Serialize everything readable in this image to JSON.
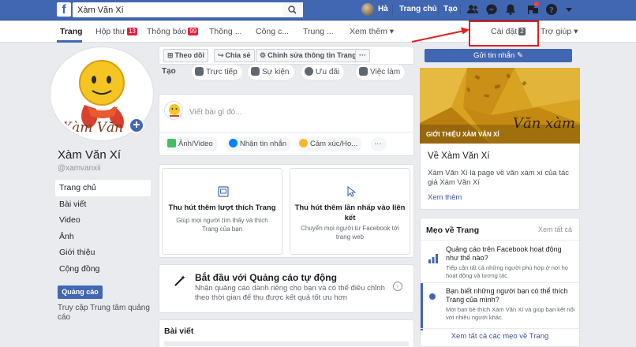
{
  "topbar": {
    "search_value": "Xàm Văn Xí",
    "user_name": "Hà",
    "home": "Trang chủ",
    "create": "Tạo",
    "icons": [
      "friends-icon",
      "messenger-icon",
      "bell-icon",
      "pages-icon",
      "help-icon",
      "caret-icon"
    ]
  },
  "pagenav": {
    "items": [
      {
        "label": "Trang"
      },
      {
        "label": "Hộp thư",
        "badge": "13"
      },
      {
        "label": "Thông báo",
        "badge": "99"
      },
      {
        "label": "Thông ..."
      },
      {
        "label": "Công c..."
      },
      {
        "label": "Trung ..."
      },
      {
        "label": "Xem thêm ▾"
      },
      {
        "label": "Cài đặt",
        "badge": "2"
      },
      {
        "label": "Trợ giúp ▾"
      }
    ]
  },
  "profile": {
    "name": "Xàm Văn Xí",
    "handle": "@xamvanxii",
    "logo_text": "Xàm Văn",
    "menu": [
      "Trang chủ",
      "Bài viết",
      "Video",
      "Ảnh",
      "Giới thiệu",
      "Cộng đồng"
    ],
    "ads_button": "Quảng cáo",
    "promo_link": "Truy cập Trung tâm quảng cáo"
  },
  "actions": {
    "follow": "Theo dõi",
    "share": "Chia sẻ",
    "edit": "Chỉnh sửa thông tin Trang",
    "more": "···"
  },
  "create": {
    "label": "Tạo",
    "items": [
      "Trực tiếp",
      "Sự kiện",
      "Ưu đãi",
      "Việc làm"
    ]
  },
  "composer": {
    "placeholder": "Viết bài gì đó...",
    "options": [
      "Ảnh/Video",
      "Nhận tin nhắn",
      "Cảm xúc/Ho...",
      "···"
    ]
  },
  "grow": [
    {
      "title": "Thu hút thêm lượt thích Trang",
      "desc": "Giúp mọi người tìm thấy và thích Trang của bạn"
    },
    {
      "title": "Thu hút thêm lần nhấp vào liên kết",
      "desc": "Chuyển mọi người từ Facebook tới trang web"
    }
  ],
  "ads_start": {
    "title": "Bắt đầu với Quảng cáo tự động",
    "desc": "Nhận quảng cáo dành riêng cho bạn và có thể điều chỉnh theo thời gian để thu được kết quả tốt ưu hơn"
  },
  "posts": {
    "title": "Bài viết"
  },
  "right": {
    "send_message": "Gửi tin nhắn",
    "cover_caption": "GIỚI THIỆU XÀM VĂN XÍ",
    "cover_script": "Văn xàm",
    "about_title": "Về Xàm Văn Xí",
    "about_desc": "Xàm Văn Xí là page về văn xàm xí của tác giả Xàm Văn Xí",
    "about_more": "Xem thêm",
    "tips_title": "Mẹo về Trang",
    "tips_see_all": "Xem tất cả",
    "tips": [
      {
        "title": "Quảng cáo trên Facebook hoạt động như thế nào?",
        "desc": "Tiếp cận tất cả những người phù hợp ở nơi họ hoạt động và tương tác."
      },
      {
        "title": "Bạn biết những người bạn có thể thích Trang của mình?",
        "desc": "Mời bạn bè thích Xàm Văn Xí và giúp bạn kết nối với nhiều người khác."
      }
    ],
    "tips_footer": "Xem tất cả các mẹo về Trang"
  },
  "colors": {
    "brand": "#4267b2",
    "highlight": "#e02020",
    "badge": "#e41e3f",
    "cover": "#d7a320"
  }
}
